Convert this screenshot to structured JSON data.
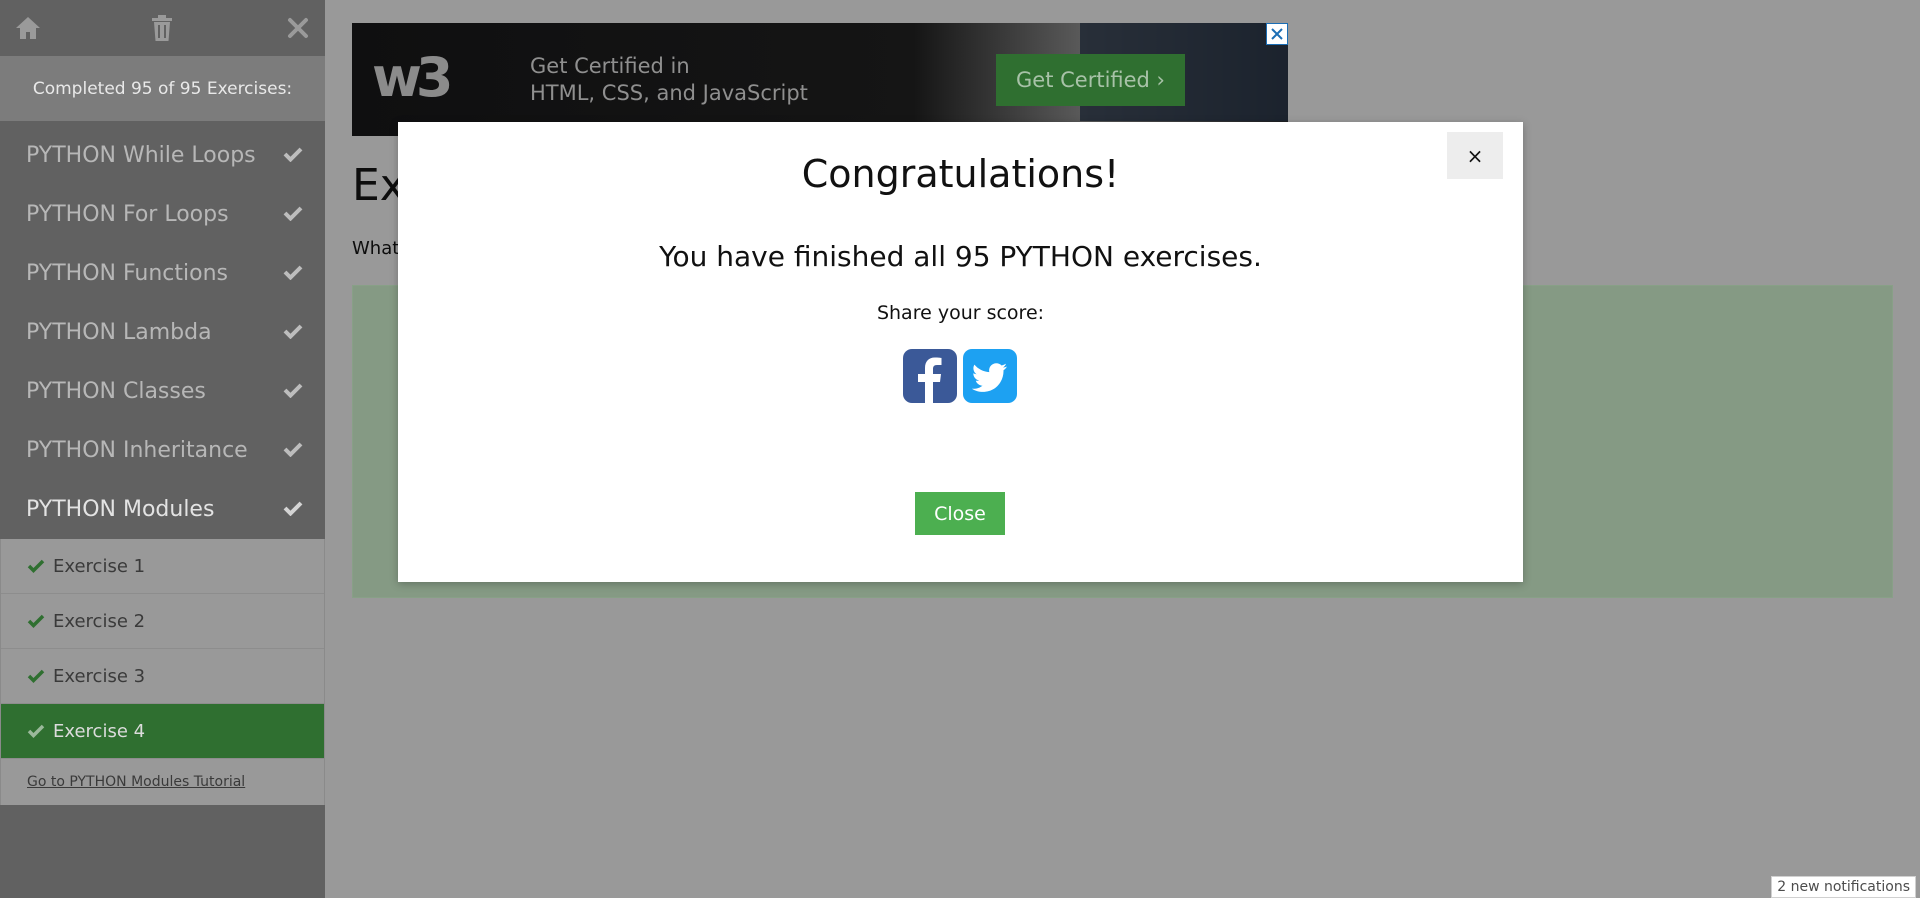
{
  "sidebar": {
    "progress_text": "Completed 95 of 95 Exercises:",
    "categories": [
      {
        "label": "PYTHON While Loops"
      },
      {
        "label": "PYTHON For Loops"
      },
      {
        "label": "PYTHON Functions"
      },
      {
        "label": "PYTHON Lambda"
      },
      {
        "label": "PYTHON Classes"
      },
      {
        "label": "PYTHON Inheritance"
      },
      {
        "label": "PYTHON Modules"
      }
    ],
    "exercises": [
      {
        "label": "Exercise 1"
      },
      {
        "label": "Exercise 2"
      },
      {
        "label": "Exercise 3"
      },
      {
        "label": "Exercise 4"
      }
    ],
    "tutorial_link": "Go to PYTHON Modules Tutorial"
  },
  "ad": {
    "logo": "w3",
    "headline_line1": "Get Certified in",
    "headline_line2": "HTML, CSS, and JavaScript",
    "cta": "Get Certified ›"
  },
  "main": {
    "title_partial": "Ex",
    "question_partial": "What"
  },
  "modal": {
    "close_x": "×",
    "title": "Congratulations!",
    "message": "You have finished all 95 PYTHON exercises.",
    "share_label": "Share your score:",
    "close_button": "Close"
  },
  "notifications": "2 new notifications",
  "colors": {
    "sidebar_bg": "#616161",
    "current_exercise": "#2f6f30",
    "close_button": "#4caf50",
    "facebook": "#3b5998",
    "twitter": "#1da1f2"
  }
}
